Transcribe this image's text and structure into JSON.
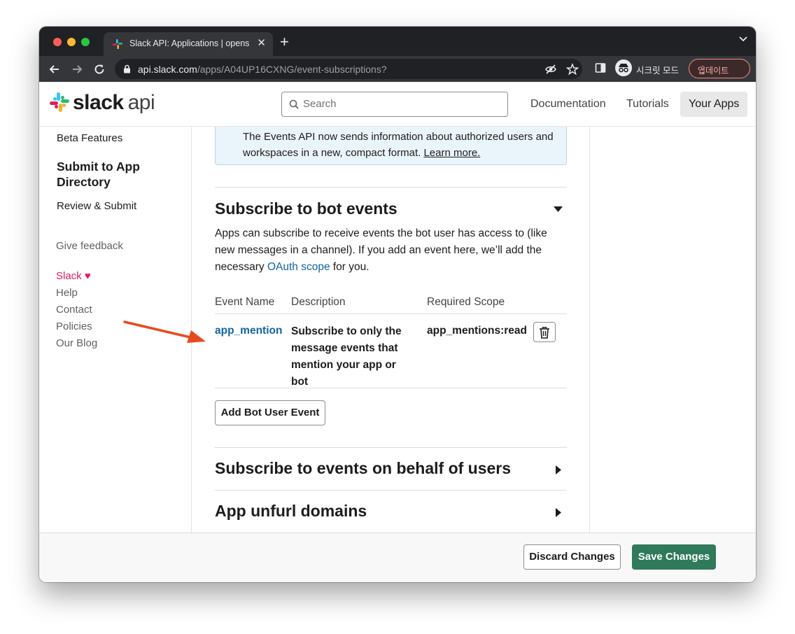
{
  "browser": {
    "tab_title": "Slack API: Applications | opens",
    "tab_close": "✕",
    "new_tab": "+",
    "url_host": "api.slack.com",
    "url_path": "/apps/A04UP16CXNG/event-subscriptions?",
    "incognito_label": "시크릿 모드",
    "update_label": "업데이트",
    "update_menu": "⋮"
  },
  "header": {
    "logo_word": "slack",
    "logo_suffix": "api",
    "search_placeholder": "Search",
    "nav": [
      "Documentation",
      "Tutorials",
      "Your Apps"
    ]
  },
  "sidebar": {
    "beta_features": "Beta Features",
    "section_title": "Submit to App Directory",
    "review_submit": "Review & Submit",
    "give_feedback": "Give feedback",
    "slack_label": "Slack",
    "heart": "♥",
    "footer_links": [
      "Help",
      "Contact",
      "Policies",
      "Our Blog"
    ]
  },
  "content": {
    "info_text": "The Events API now sends information about authorized users and workspaces in a new, compact format.",
    "info_link": "Learn more.",
    "bot_events_title": "Subscribe to bot events",
    "bot_events_desc_1": "Apps can subscribe to receive events the bot user has access to (like new messages in a channel). If you add an event here, we’ll add the necessary ",
    "bot_events_desc_link": "OAuth scope",
    "bot_events_desc_2": " for you.",
    "table_headers": [
      "Event Name",
      "Description",
      "Required Scope"
    ],
    "event": {
      "name": "app_mention",
      "description": "Subscribe to only the message events that mention your app or bot",
      "scope": "app_mentions:read"
    },
    "add_button": "Add Bot User Event",
    "user_events_title": "Subscribe to events on behalf of users",
    "unfurl_title": "App unfurl domains"
  },
  "footer": {
    "discard": "Discard Changes",
    "save": "Save Changes"
  },
  "colors": {
    "link": "#1264a3",
    "save_button": "#2e7a5a",
    "annotation_arrow": "#e84a1f"
  }
}
